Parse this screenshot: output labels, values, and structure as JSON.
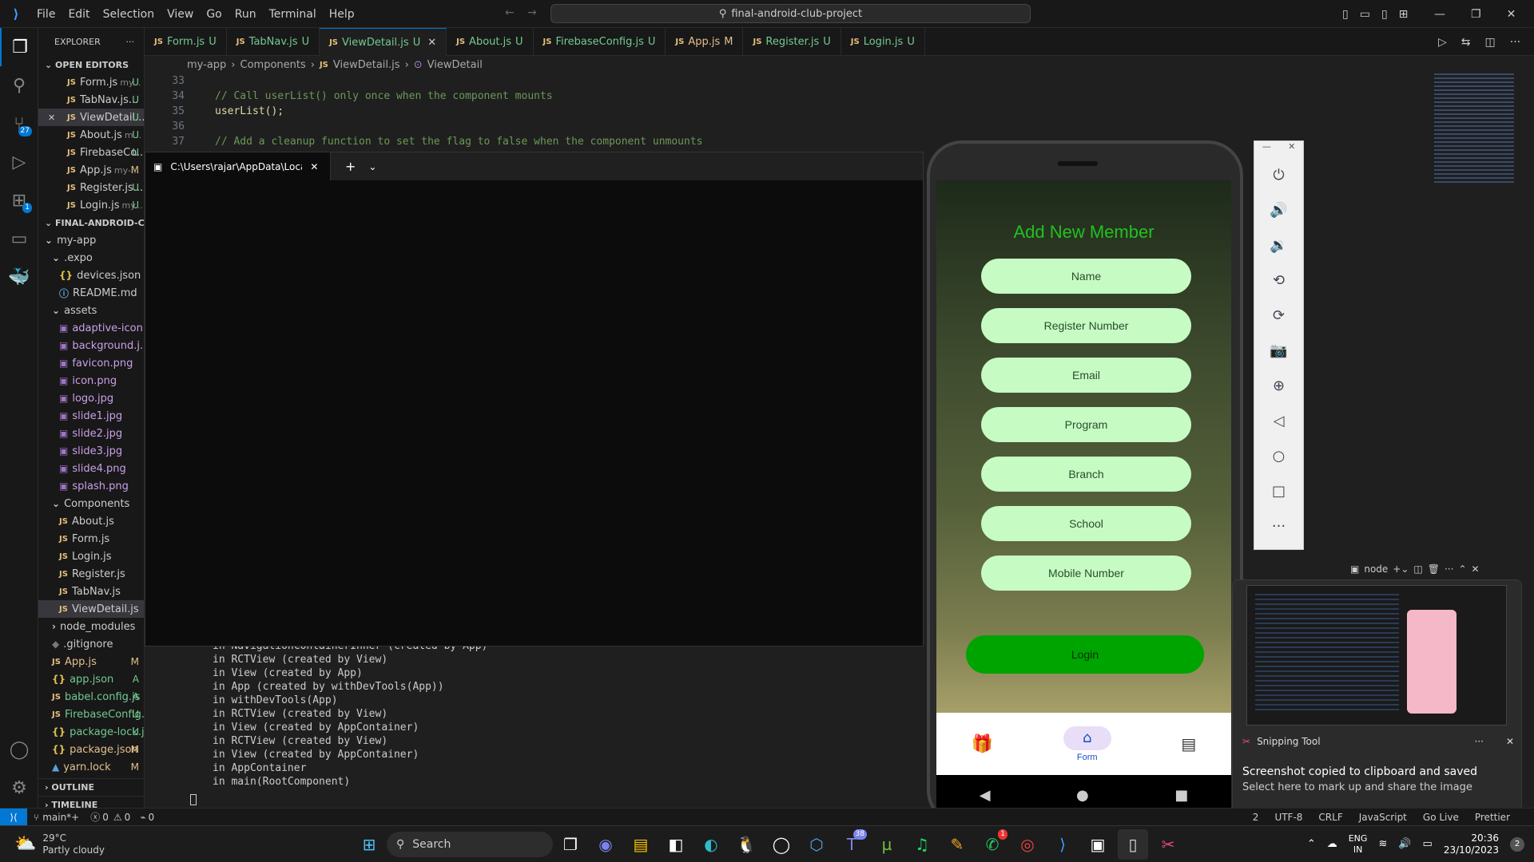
{
  "menu": {
    "items": [
      "File",
      "Edit",
      "Selection",
      "View",
      "Go",
      "Run",
      "Terminal",
      "Help"
    ]
  },
  "command_center": {
    "label": "final-android-club-project"
  },
  "explorer": {
    "title": "EXPLORER",
    "open_editors_title": "OPEN EDITORS",
    "open_editors": [
      {
        "name": "Form.js",
        "hint": "my...",
        "status": "U"
      },
      {
        "name": "TabNav.js...",
        "hint": "",
        "status": "U"
      },
      {
        "name": "ViewDetail...",
        "hint": "",
        "status": "U"
      },
      {
        "name": "About.js",
        "hint": "m...",
        "status": "U"
      },
      {
        "name": "FirebaseCo...",
        "hint": "",
        "status": "U"
      },
      {
        "name": "App.js",
        "hint": "my-...",
        "status": "M"
      },
      {
        "name": "Register.js...",
        "hint": "",
        "status": "U"
      },
      {
        "name": "Login.js",
        "hint": "my...",
        "status": "U"
      }
    ],
    "project_title": "FINAL-ANDROID-CLUB-PROJECT",
    "tree": [
      {
        "label": "my-app",
        "kind": "folder"
      },
      {
        "label": ".expo",
        "kind": "folder"
      },
      {
        "label": "devices.json",
        "kind": "json",
        "status": ""
      },
      {
        "label": "README.md",
        "kind": "info",
        "status": ""
      },
      {
        "label": "assets",
        "kind": "folder"
      },
      {
        "label": "adaptive-icon...",
        "kind": "img"
      },
      {
        "label": "background.j...",
        "kind": "img"
      },
      {
        "label": "favicon.png",
        "kind": "img"
      },
      {
        "label": "icon.png",
        "kind": "img"
      },
      {
        "label": "logo.jpg",
        "kind": "img"
      },
      {
        "label": "slide1.jpg",
        "kind": "img"
      },
      {
        "label": "slide2.jpg",
        "kind": "img"
      },
      {
        "label": "slide3.jpg",
        "kind": "img"
      },
      {
        "label": "slide4.png",
        "kind": "img"
      },
      {
        "label": "splash.png",
        "kind": "img"
      },
      {
        "label": "Components",
        "kind": "folder"
      },
      {
        "label": "About.js",
        "kind": "js"
      },
      {
        "label": "Form.js",
        "kind": "js"
      },
      {
        "label": "Login.js",
        "kind": "js"
      },
      {
        "label": "Register.js",
        "kind": "js"
      },
      {
        "label": "TabNav.js",
        "kind": "js"
      },
      {
        "label": "ViewDetail.js",
        "kind": "js"
      },
      {
        "label": "node_modules",
        "kind": "folder"
      },
      {
        "label": ".gitignore",
        "kind": "git"
      },
      {
        "label": "App.js",
        "kind": "js",
        "status": "M"
      },
      {
        "label": "app.json",
        "kind": "json",
        "status": "A"
      },
      {
        "label": "babel.config.js",
        "kind": "js",
        "status": "A"
      },
      {
        "label": "FirebaseConfig.js",
        "kind": "js",
        "status": "U"
      },
      {
        "label": "package-lock.js...",
        "kind": "json",
        "status": "U"
      },
      {
        "label": "package.json",
        "kind": "json",
        "status": "M"
      },
      {
        "label": "yarn.lock",
        "kind": "lock",
        "status": "M"
      }
    ],
    "outline": "OUTLINE",
    "timeline": "TIMELINE"
  },
  "tabs": [
    {
      "label": "Form.js",
      "status": "U"
    },
    {
      "label": "TabNav.js",
      "status": "U"
    },
    {
      "label": "ViewDetail.js",
      "status": "U",
      "active": true
    },
    {
      "label": "About.js",
      "status": "U"
    },
    {
      "label": "FirebaseConfig.js",
      "status": "U"
    },
    {
      "label": "App.js",
      "status": "M"
    },
    {
      "label": "Register.js",
      "status": "U"
    },
    {
      "label": "Login.js",
      "status": "U"
    }
  ],
  "breadcrumb": [
    "my-app",
    "Components",
    "ViewDetail.js",
    "ViewDetail"
  ],
  "code": [
    {
      "n": "33",
      "text": ""
    },
    {
      "n": "34",
      "text": "// Call userList() only once when the component mounts"
    },
    {
      "n": "35",
      "text": "userList();"
    },
    {
      "n": "36",
      "text": ""
    },
    {
      "n": "37",
      "text": "// Add a cleanup function to set the flag to false when the component unmounts"
    }
  ],
  "terminal_window": {
    "tab_title": "C:\\Users\\rajar\\AppData\\Local"
  },
  "panel_lines": [
    "in NavigationContainerInner (created by App)",
    "in RCTView (created by View)",
    "in View (created by App)",
    "in App (created by withDevTools(App))",
    "in withDevTools(App)",
    "in RCTView (created by View)",
    "in View (created by AppContainer)",
    "in RCTView (created by View)",
    "in View (created by AppContainer)",
    "in AppContainer",
    "in main(RootComponent)"
  ],
  "node_terminal": {
    "label": "node"
  },
  "app": {
    "title": "Add New Member",
    "fields": [
      "Name",
      "Register Number",
      "Email",
      "Program",
      "Branch",
      "School",
      "Mobile Number"
    ],
    "login": "Login",
    "nav_form": "Form"
  },
  "toast": {
    "app": "Snipping Tool",
    "title": "Screenshot copied to clipboard and saved",
    "body": "Select here to mark up and share the image"
  },
  "statusbar": {
    "branch": "main*+",
    "errors": "0",
    "warnings": "0",
    "ports": "0",
    "line": "2",
    "encoding": "UTF-8",
    "eol": "CRLF",
    "language": "JavaScript",
    "golive": "Go Live",
    "prettier": "Prettier"
  },
  "taskbar": {
    "weather_temp": "29°C",
    "weather_desc": "Partly cloudy",
    "search": "Search",
    "lang": "ENG",
    "region": "IN",
    "time": "20:36",
    "date": "23/10/2023",
    "notif": "2",
    "teams_badge": "38",
    "whatsapp_badge": "1"
  },
  "colors": {
    "accent": "#0078d4",
    "app_input_bg": "#c6fcc4",
    "app_login_bg": "#00a400",
    "app_title": "#22c022"
  }
}
